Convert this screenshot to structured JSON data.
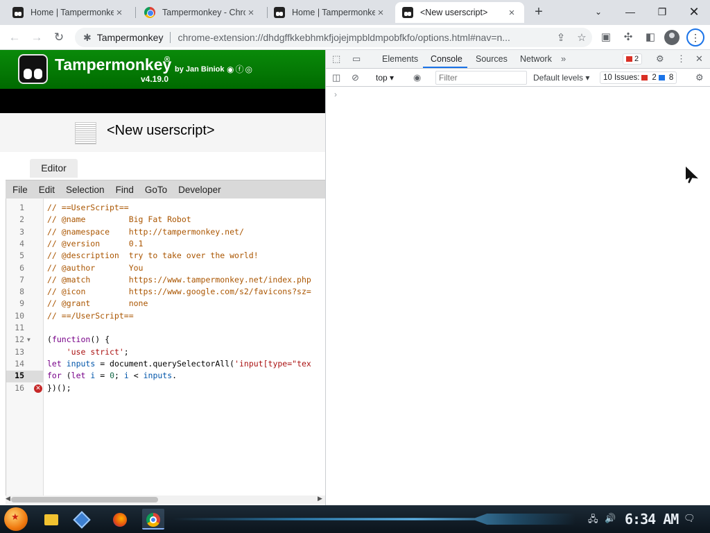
{
  "browser": {
    "tabs": [
      {
        "title": "Home | Tampermonkey",
        "favicon": "tampermonkey-icon"
      },
      {
        "title": "Tampermonkey - Chrome Web Store",
        "favicon": "chrome-web-store-icon"
      },
      {
        "title": "Home | Tampermonkey",
        "favicon": "tampermonkey-icon"
      },
      {
        "title": "<New userscript>",
        "favicon": "tampermonkey-icon",
        "active": true
      }
    ],
    "site_chip": "Tampermonkey",
    "url": "chrome-extension://dhdgffkkebhmkfjojejmpbldmpobfkfo/options.html#nav=n..."
  },
  "tampermonkey": {
    "brand": "Tampermonkey",
    "registered": "®",
    "by": "by Jan Biniok",
    "version": "v4.19.0",
    "script_title": "<New userscript>",
    "editor_tab": "Editor",
    "menu": [
      "File",
      "Edit",
      "Selection",
      "Find",
      "GoTo",
      "Developer"
    ],
    "code_lines": [
      {
        "n": "1",
        "text": "// ==UserScript=="
      },
      {
        "n": "2",
        "text": "// @name         Big Fat Robot"
      },
      {
        "n": "3",
        "text": "// @namespace    http://tampermonkey.net/"
      },
      {
        "n": "4",
        "text": "// @version      0.1"
      },
      {
        "n": "5",
        "text": "// @description  try to take over the world!"
      },
      {
        "n": "6",
        "text": "// @author       You"
      },
      {
        "n": "7",
        "text": "// @match        https://www.tampermonkey.net/index.php"
      },
      {
        "n": "8",
        "text": "// @icon         https://www.google.com/s2/favicons?sz="
      },
      {
        "n": "9",
        "text": "// @grant        none"
      },
      {
        "n": "10",
        "text": "// ==/UserScript=="
      },
      {
        "n": "11",
        "text": ""
      },
      {
        "n": "12",
        "text": "(function() {"
      },
      {
        "n": "13",
        "text": "    'use strict';"
      },
      {
        "n": "14",
        "text": "let inputs = document.querySelectorAll('input[type=\"tex"
      },
      {
        "n": "15",
        "text": "for (let i = 0; i < inputs."
      },
      {
        "n": "16",
        "text": "})();"
      }
    ],
    "active_line": "15",
    "error_line": "16"
  },
  "devtools": {
    "tabs": [
      "Elements",
      "Console",
      "Sources",
      "Network"
    ],
    "active_tab": "Console",
    "error_count": "2",
    "context": "top",
    "filter_placeholder": "Filter",
    "levels": "Default levels",
    "issues_label": "10 Issues:",
    "issues_errors": "2",
    "issues_info": "8",
    "prompt": "›"
  },
  "taskbar": {
    "time": "6:34 AM"
  },
  "colors": {
    "tm_green": "#0a8a0a",
    "devtools_accent": "#1a73e8",
    "error_red": "#d93025"
  }
}
